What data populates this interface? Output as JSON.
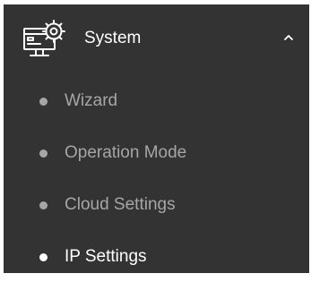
{
  "menu": {
    "title": "System",
    "icon": "system-settings-icon",
    "expanded_icon": "chevron-up-icon",
    "items": [
      {
        "label": "Wizard",
        "active": false
      },
      {
        "label": "Operation Mode",
        "active": false
      },
      {
        "label": "Cloud Settings",
        "active": false
      },
      {
        "label": "IP Settings",
        "active": true
      }
    ]
  },
  "colors": {
    "panel_background": "#333333",
    "title_text": "#ffffff",
    "inactive_text": "#a6a6a6",
    "inactive_bullet": "#a6a6a6",
    "active_text": "#ffffff",
    "active_bullet": "#ffffff"
  }
}
